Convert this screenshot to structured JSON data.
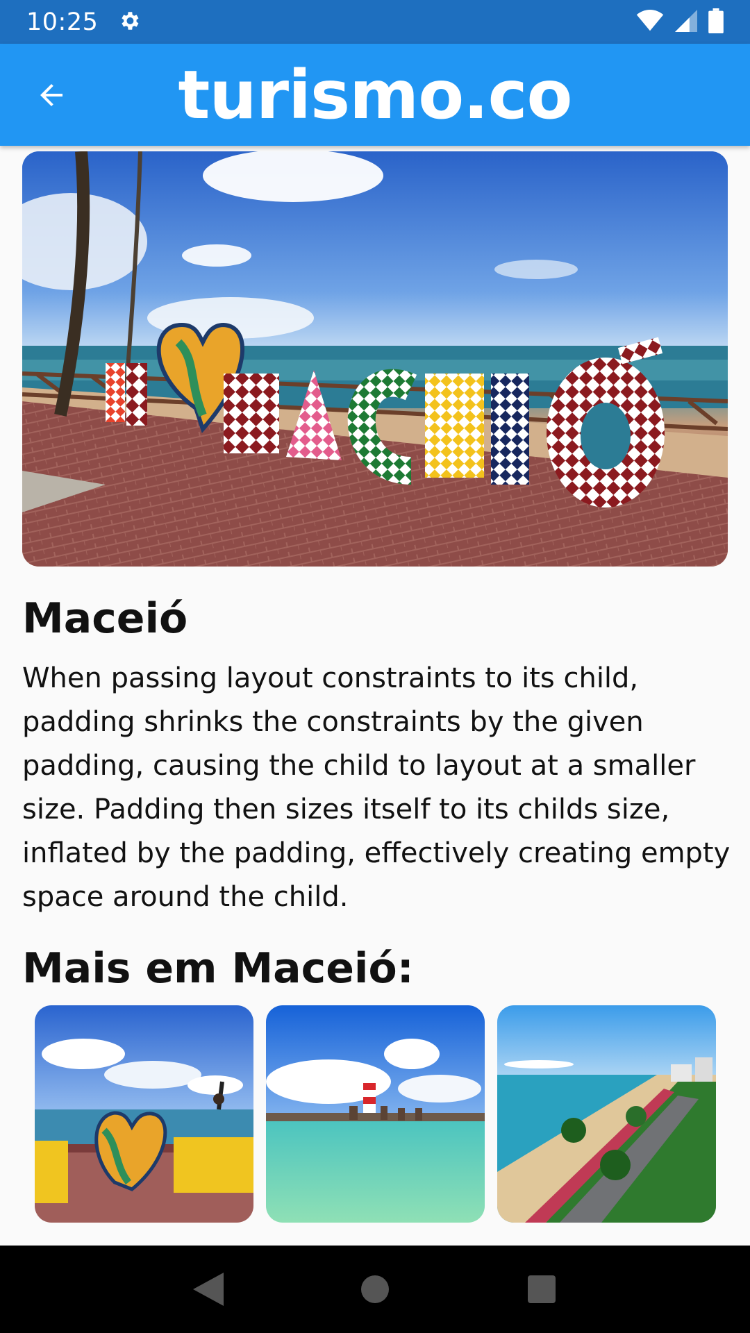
{
  "status_bar": {
    "time": "10:25",
    "icons": [
      "settings-icon",
      "wifi-icon",
      "signal-icon",
      "battery-icon"
    ]
  },
  "app_bar": {
    "title": "turismo.co",
    "back_icon": "arrow-back-icon",
    "background": "#2196f3"
  },
  "hero": {
    "sign_text": "EU MACEIÓ"
  },
  "content": {
    "title": "Maceió",
    "description": "When passing layout constraints to its child, padding shrinks the constraints by the given padding, causing the child to layout at a smaller size. Padding then sizes itself to its childs size, inflated by the padding, effectively creating empty space around the child.",
    "more_title": "Mais em Maceió:"
  },
  "thumbnails": [
    {
      "sign_text": "U MAC"
    },
    {},
    {}
  ],
  "nav_bar": {
    "icons": [
      "back-triangle-icon",
      "home-circle-icon",
      "recents-square-icon"
    ]
  }
}
